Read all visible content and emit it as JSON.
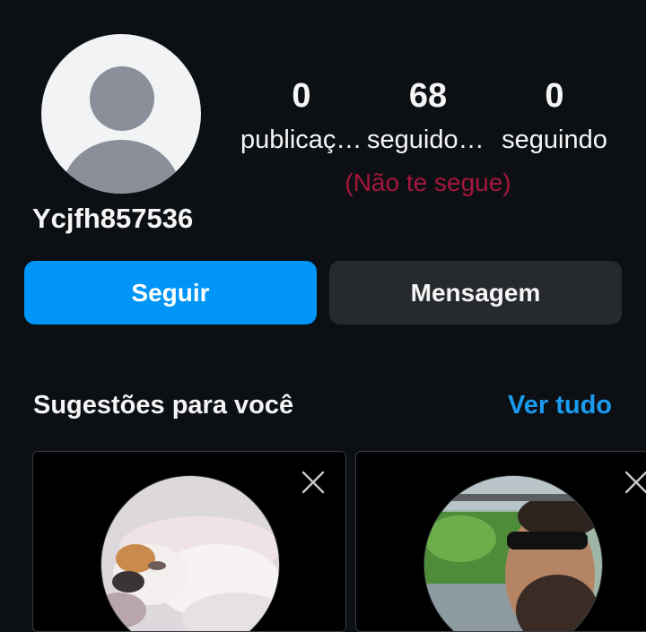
{
  "profile": {
    "username": "Ycjfh857536",
    "stats": [
      {
        "value": "0",
        "label": "publicações"
      },
      {
        "value": "68",
        "label": "seguidores"
      },
      {
        "value": "0",
        "label": "seguindo"
      }
    ],
    "relationship_note": "(Não te segue)"
  },
  "actions": {
    "follow_label": "Seguir",
    "message_label": "Mensagem"
  },
  "suggestions": {
    "title": "Sugestões para você",
    "see_all_label": "Ver tudo",
    "cards": [
      {
        "photo_icon": "cat-photo"
      },
      {
        "photo_icon": "man-sunglasses-photo"
      }
    ]
  },
  "colors": {
    "background": "#0c1014",
    "primary_button": "#0095f6",
    "secondary_button": "#26292e",
    "link": "#1a9bf0",
    "note": "#a5173a"
  }
}
